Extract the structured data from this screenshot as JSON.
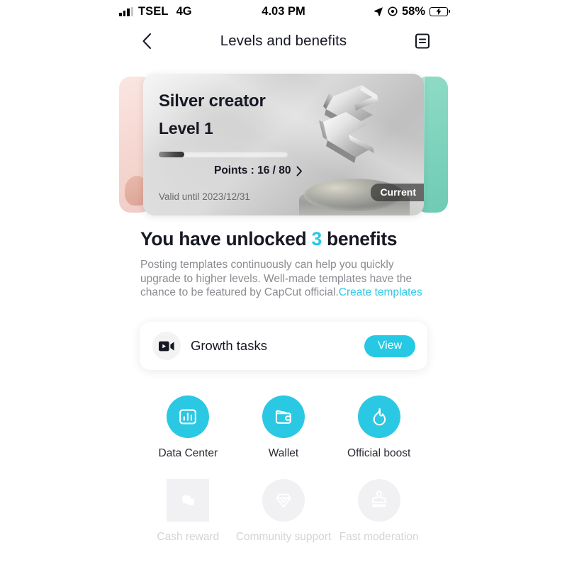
{
  "status_bar": {
    "carrier": "TSEL",
    "network": "4G",
    "time": "4.03 PM",
    "battery_percent": "58%",
    "battery_level": 58,
    "charging": true,
    "icons": [
      "signal-bars-icon",
      "location-arrow-icon",
      "alarm-icon",
      "battery-charging-icon"
    ]
  },
  "nav": {
    "back_icon": "chevron-left-icon",
    "title": "Levels and benefits",
    "menu_icon": "rules-list-icon"
  },
  "level_card": {
    "tier": "Silver creator",
    "level": "Level 1",
    "points_label": "Points : 16 / 80",
    "points_current": 16,
    "points_total": 80,
    "progress_percent": 20,
    "valid_until": "Valid until 2023/12/31",
    "badge": "Current",
    "chevron_icon": "chevron-right-icon",
    "medal_icon": "capcut-3d-logo",
    "peek_left_color": "#f4d8d2",
    "peek_right_color": "#7ed3bd"
  },
  "headline": {
    "before": "You have unlocked ",
    "count": "3",
    "after": " benefits"
  },
  "description": {
    "text": "Posting templates continuously can help you quickly upgrade to higher levels. Well-made templates have the chance to be featured by CapCut official.",
    "link": "Create templates"
  },
  "growth_tasks": {
    "icon": "video-camera-icon",
    "label": "Growth tasks",
    "button": "View"
  },
  "benefits": {
    "unlocked": [
      {
        "icon": "bar-chart-icon",
        "label": "Data Center"
      },
      {
        "icon": "wallet-icon",
        "label": "Wallet"
      },
      {
        "icon": "flame-icon",
        "label": "Official boost"
      }
    ],
    "locked": [
      {
        "icon": "coins-icon",
        "label": "Cash reward"
      },
      {
        "icon": "diamond-icon",
        "label": "Community support"
      },
      {
        "icon": "stamp-icon",
        "label": "Fast moderation"
      }
    ]
  },
  "colors": {
    "accent": "#27C8E4",
    "text_primary": "#161823",
    "text_muted": "#8a8b91",
    "locked": "#d3d4d8",
    "battery_green": "#32d04a"
  }
}
